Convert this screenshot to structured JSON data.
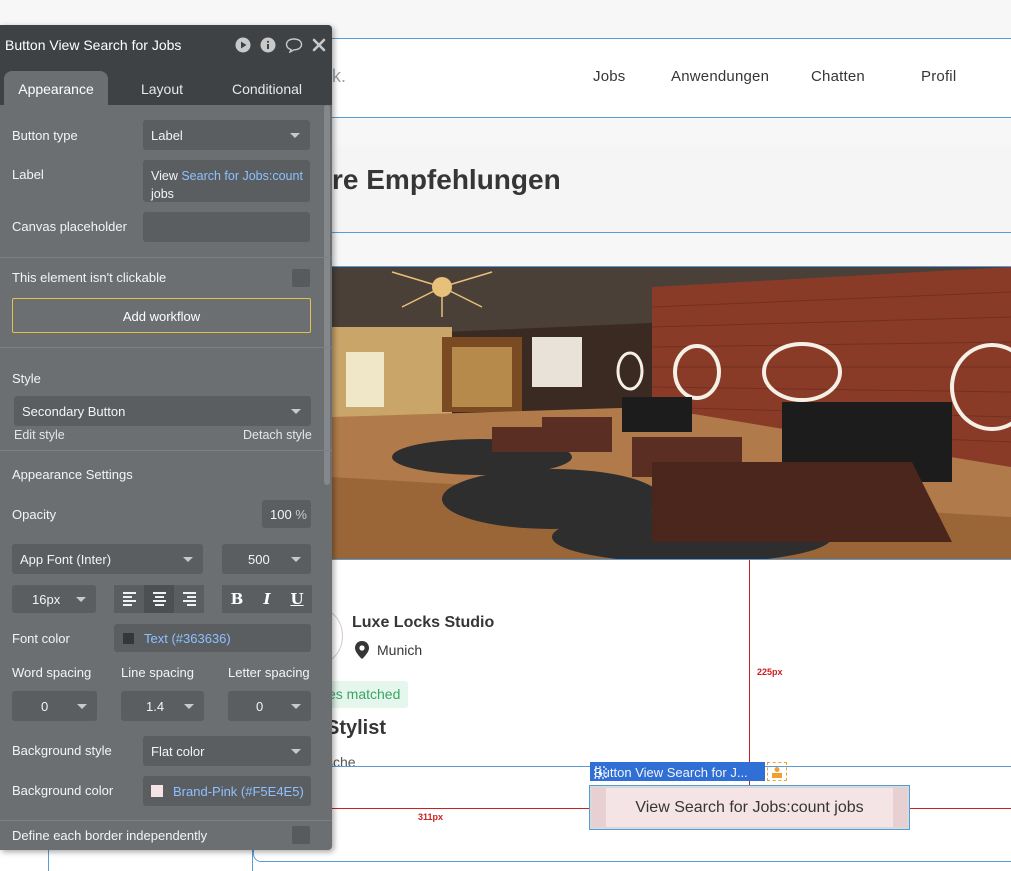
{
  "canvas": {
    "logo_fragment": "k.",
    "nav": [
      "Jobs",
      "Anwendungen",
      "Chatten",
      "Profil"
    ],
    "page_title": "re Empfehlungen",
    "card": {
      "company": "Luxe Locks Studio",
      "location": "Munich",
      "matched_badge": "es matched",
      "job_title": "Stylist",
      "job_subtitle": "sche"
    },
    "dimension_vertical": "225px",
    "dimension_horizontal": "311px",
    "selection_tag": "Button View Search for J...",
    "selected_button_label": "View Search for Jobs:count jobs"
  },
  "panel": {
    "title": "Button View Search for Jobs",
    "tabs": [
      "Appearance",
      "Layout",
      "Conditional"
    ],
    "button_type": {
      "label": "Button type",
      "value": "Label"
    },
    "label_field": {
      "label": "Label",
      "prefix": "View ",
      "dynamic": "Search for Jobs:count",
      "suffix": "jobs"
    },
    "canvas_placeholder": {
      "label": "Canvas placeholder",
      "value": ""
    },
    "not_clickable": "This element isn't clickable",
    "add_workflow": "Add workflow",
    "style": {
      "label": "Style",
      "value": "Secondary Button",
      "edit": "Edit style",
      "detach": "Detach style"
    },
    "appearance_settings": "Appearance Settings",
    "opacity": {
      "label": "Opacity",
      "value": "100",
      "unit": "%"
    },
    "font": {
      "family": "App Font (Inter)",
      "weight": "500",
      "size": "16px"
    },
    "font_color": {
      "label": "Font color",
      "value": "Text (#363636)",
      "swatch": "#363636"
    },
    "spacing": {
      "word_label": "Word spacing",
      "word_value": "0",
      "line_label": "Line spacing",
      "line_value": "1.4",
      "letter_label": "Letter spacing",
      "letter_value": "0"
    },
    "background_style": {
      "label": "Background style",
      "value": "Flat color"
    },
    "background_color": {
      "label": "Background color",
      "value": "Brand-Pink (#F5E4E5)",
      "swatch": "#F5E4E5"
    },
    "border_independent": "Define each border independently",
    "format_buttons": [
      "B",
      "I",
      "U"
    ]
  }
}
